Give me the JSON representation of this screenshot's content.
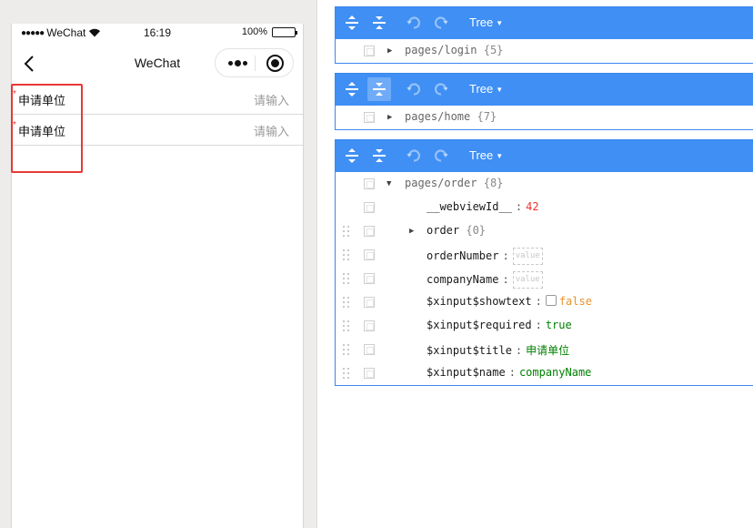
{
  "statusbar": {
    "dots": "●●●●●",
    "carrier": "WeChat",
    "time": "16:19",
    "battery": "100%"
  },
  "navbar": {
    "title": "WeChat"
  },
  "form": {
    "rows": [
      {
        "required_mark": "*",
        "label": "申请单位",
        "placeholder": "请输入"
      },
      {
        "required_mark": "*",
        "label": "申请单位",
        "placeholder": "请输入"
      }
    ]
  },
  "colors": {
    "menu_blue": "#3f8ff4",
    "highlight_red": "#e53935",
    "string_green": "#008000",
    "number_red": "#ee3333",
    "boolean_orange": "#e8922f"
  },
  "panels": [
    {
      "mode": "Tree",
      "root": {
        "key": "pages/login",
        "count": "{5}",
        "expanded": false
      }
    },
    {
      "mode": "Tree",
      "root": {
        "key": "pages/home",
        "count": "{7}",
        "expanded": false
      }
    },
    {
      "mode": "Tree",
      "root": {
        "key": "pages/order",
        "count": "{8}",
        "expanded": true
      },
      "children": [
        {
          "key": "__webviewId__",
          "value": "42",
          "type": "number"
        },
        {
          "key": "order",
          "count": "{0}",
          "type": "object"
        },
        {
          "key": "orderNumber",
          "value": "value",
          "type": "empty"
        },
        {
          "key": "companyName",
          "value": "value",
          "type": "empty"
        },
        {
          "key": "$xinput$showtext",
          "value": "false",
          "type": "boolean"
        },
        {
          "key": "$xinput$required",
          "value": "true",
          "type": "boolean-true"
        },
        {
          "key": "$xinput$title",
          "value": "申请单位",
          "type": "string"
        },
        {
          "key": "$xinput$name",
          "value": "companyName",
          "type": "string"
        }
      ]
    }
  ]
}
